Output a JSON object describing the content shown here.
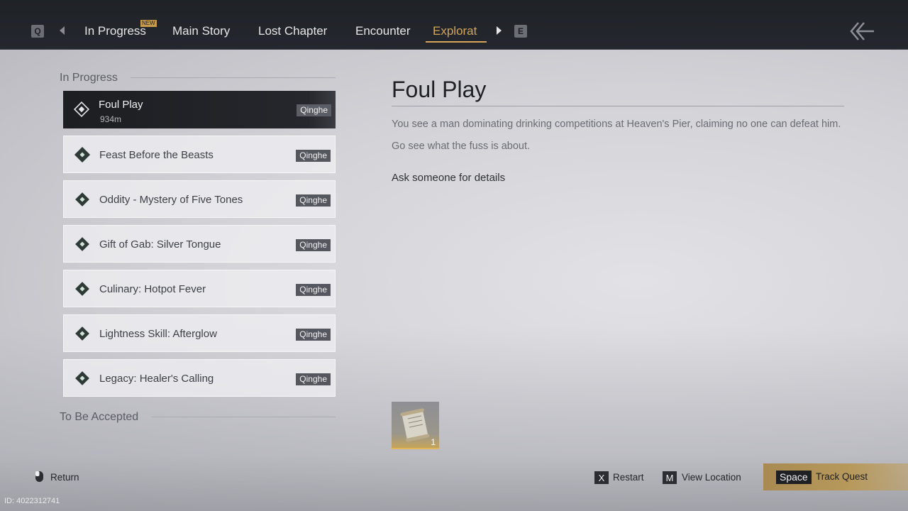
{
  "topbar": {
    "prev_key": "Q",
    "next_key": "E",
    "tabs": [
      {
        "label": "In Progress",
        "badge": "NEW"
      },
      {
        "label": "Main Story"
      },
      {
        "label": "Lost Chapter"
      },
      {
        "label": "Encounter"
      },
      {
        "label": "Explorat"
      }
    ],
    "active_tab": "Explorat"
  },
  "sections": {
    "in_progress_label": "In Progress",
    "to_be_accepted_label": "To Be Accepted"
  },
  "quests": [
    {
      "title": "Foul Play",
      "distance": "934m",
      "region": "Qinghe",
      "selected": true
    },
    {
      "title": "Feast Before the Beasts",
      "region": "Qinghe"
    },
    {
      "title": "Oddity - Mystery of Five Tones",
      "region": "Qinghe"
    },
    {
      "title": "Gift of Gab: Silver Tongue",
      "region": "Qinghe"
    },
    {
      "title": "Culinary: Hotpot Fever",
      "region": "Qinghe"
    },
    {
      "title": "Lightness Skill: Afterglow",
      "region": "Qinghe"
    },
    {
      "title": "Legacy: Healer's Calling",
      "region": "Qinghe"
    }
  ],
  "detail": {
    "title": "Foul Play",
    "description": "You see a man dominating drinking competitions at Heaven's Pier, claiming no one can defeat him. Go see what the fuss is about.",
    "objective": "Ask someone for details",
    "reward_count": "1"
  },
  "footer": {
    "return_label": "Return",
    "restart_key": "X",
    "restart_label": "Restart",
    "location_key": "M",
    "location_label": "View Location",
    "track_key": "Space",
    "track_label": "Track Quest",
    "id_text": "ID: 4022312741"
  },
  "colors": {
    "accent_gold": "#d4a55a",
    "topbar_bg": "#1f2227",
    "active_row_bg": "#1c1e22"
  }
}
